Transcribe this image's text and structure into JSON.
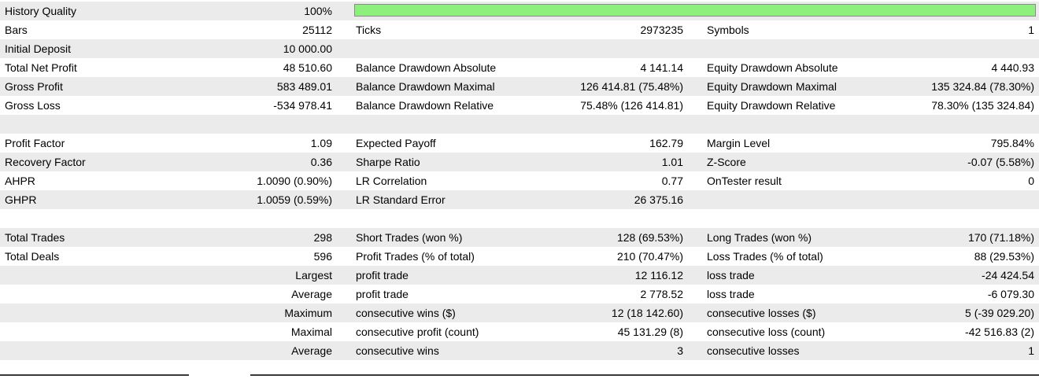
{
  "history_quality": {
    "label": "History Quality",
    "value": "100%",
    "fraction": 1.0,
    "bar_color": "#8ef07c"
  },
  "rows": [
    {
      "cells": [
        "Bars",
        "25112",
        "Ticks",
        "2973235",
        "Symbols",
        "1"
      ]
    },
    {
      "cells": [
        "Initial Deposit",
        "10 000.00",
        "",
        "",
        "",
        ""
      ]
    },
    {
      "cells": [
        "Total Net Profit",
        "48 510.60",
        "Balance Drawdown Absolute",
        "4 141.14",
        "Equity Drawdown Absolute",
        "4 440.93"
      ]
    },
    {
      "cells": [
        "Gross Profit",
        "583 489.01",
        "Balance Drawdown Maximal",
        "126 414.81 (75.48%)",
        "Equity Drawdown Maximal",
        "135 324.84 (78.30%)"
      ]
    },
    {
      "cells": [
        "Gross Loss",
        "-534 978.41",
        "Balance Drawdown Relative",
        "75.48% (126 414.81)",
        "Equity Drawdown Relative",
        "78.30% (135 324.84)"
      ]
    },
    {
      "cells": [
        "",
        "",
        "",
        "",
        "",
        ""
      ]
    },
    {
      "cells": [
        "Profit Factor",
        "1.09",
        "Expected Payoff",
        "162.79",
        "Margin Level",
        "795.84%"
      ]
    },
    {
      "cells": [
        "Recovery Factor",
        "0.36",
        "Sharpe Ratio",
        "1.01",
        "Z-Score",
        "-0.07 (5.58%)"
      ]
    },
    {
      "cells": [
        "AHPR",
        "1.0090 (0.90%)",
        "LR Correlation",
        "0.77",
        "OnTester result",
        "0"
      ]
    },
    {
      "cells": [
        "GHPR",
        "1.0059 (0.59%)",
        "LR Standard Error",
        "26 375.16",
        "",
        ""
      ]
    },
    {
      "cells": [
        "",
        "",
        "",
        "",
        "",
        ""
      ]
    },
    {
      "cells": [
        "Total Trades",
        "298",
        "Short Trades (won %)",
        "128 (69.53%)",
        "Long Trades (won %)",
        "170 (71.18%)"
      ]
    },
    {
      "cells": [
        "Total Deals",
        "596",
        "Profit Trades (% of total)",
        "210 (70.47%)",
        "Loss Trades (% of total)",
        "88 (29.53%)"
      ]
    },
    {
      "cells": [
        "",
        "Largest",
        "profit trade",
        "12 116.12",
        "loss trade",
        "-24 424.54"
      ]
    },
    {
      "cells": [
        "",
        "Average",
        "profit trade",
        "2 778.52",
        "loss trade",
        "-6 079.30"
      ]
    },
    {
      "cells": [
        "",
        "Maximum",
        "consecutive wins ($)",
        "12 (18 142.60)",
        "consecutive losses ($)",
        "5 (-39 029.20)"
      ]
    },
    {
      "cells": [
        "",
        "Maximal",
        "consecutive profit (count)",
        "45 131.29 (8)",
        "consecutive loss (count)",
        "-42 516.83 (2)"
      ]
    },
    {
      "cells": [
        "",
        "Average",
        "consecutive wins",
        "3",
        "consecutive losses",
        "1"
      ]
    },
    {
      "cells": [
        "",
        "",
        "",
        "",
        "",
        ""
      ]
    }
  ]
}
